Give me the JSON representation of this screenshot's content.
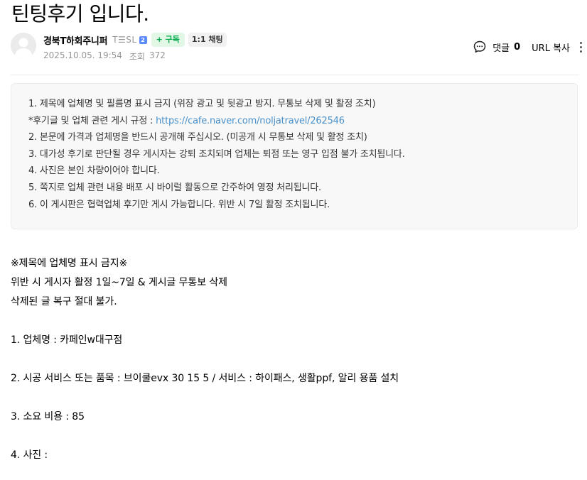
{
  "article": {
    "title": "틴팅후기 입니다."
  },
  "author": {
    "nickname": "경북T하회주니퍼",
    "level": "T☰SL",
    "level_badge": "2",
    "subscribe_label": "+ 구독",
    "chat_label": "1:1 채팅",
    "date": "2025.10.05. 19:54",
    "views_label": "조회",
    "views": "372"
  },
  "tools": {
    "comment_label": "댓글",
    "comment_count": "0",
    "url_copy_label": "URL 복사"
  },
  "notice": {
    "items": [
      "1. 제목에 업체명 및 필름명 표시 금지 (위장 광고 및 뒷광고 방지. 무통보 삭제 및 활정 조치)",
      "*후기글 및 업체 관련 게시 규정 : ",
      "2. 본문에 가격과 업체명을 반드시 공개해 주십시오. (미공개 시 무통보 삭제 및 활정 조치)",
      "3. 대가성 후기로 판단될 경우 게시자는 강퇴 조치되며 업체는 퇴점 또는 영구 입점 불가 조치됩니다.",
      "4. 사진은 본인 차량이어야 합니다.",
      "5. 쪽지로 업체 관련 내용 배포 시 바이럴 활동으로 간주하여 영정 처리됩니다.",
      "6. 이 게시판은 협력업체 후기만 게시 가능합니다. 위반 시 7일 활정 조치됩니다."
    ],
    "link": "https://cafe.naver.com/noljatravel/262546"
  },
  "body": {
    "lines": [
      "※제목에 업체명 표시 금지※",
      "위반 시 게시자 활정 1일~7일 & 게시글 무통보 삭제",
      "삭제된 글 복구 절대 불가.",
      "",
      "1. 업체명 :  카페인w대구점",
      "",
      "2. 시공 서비스 또는 품목 :  브이쿨evx 30 15 5 / 서비스 : 하이패스, 생활ppf, 알리 용품 설치",
      "",
      "3. 소요 비용 :  85",
      "",
      "4. 사진 :"
    ]
  }
}
